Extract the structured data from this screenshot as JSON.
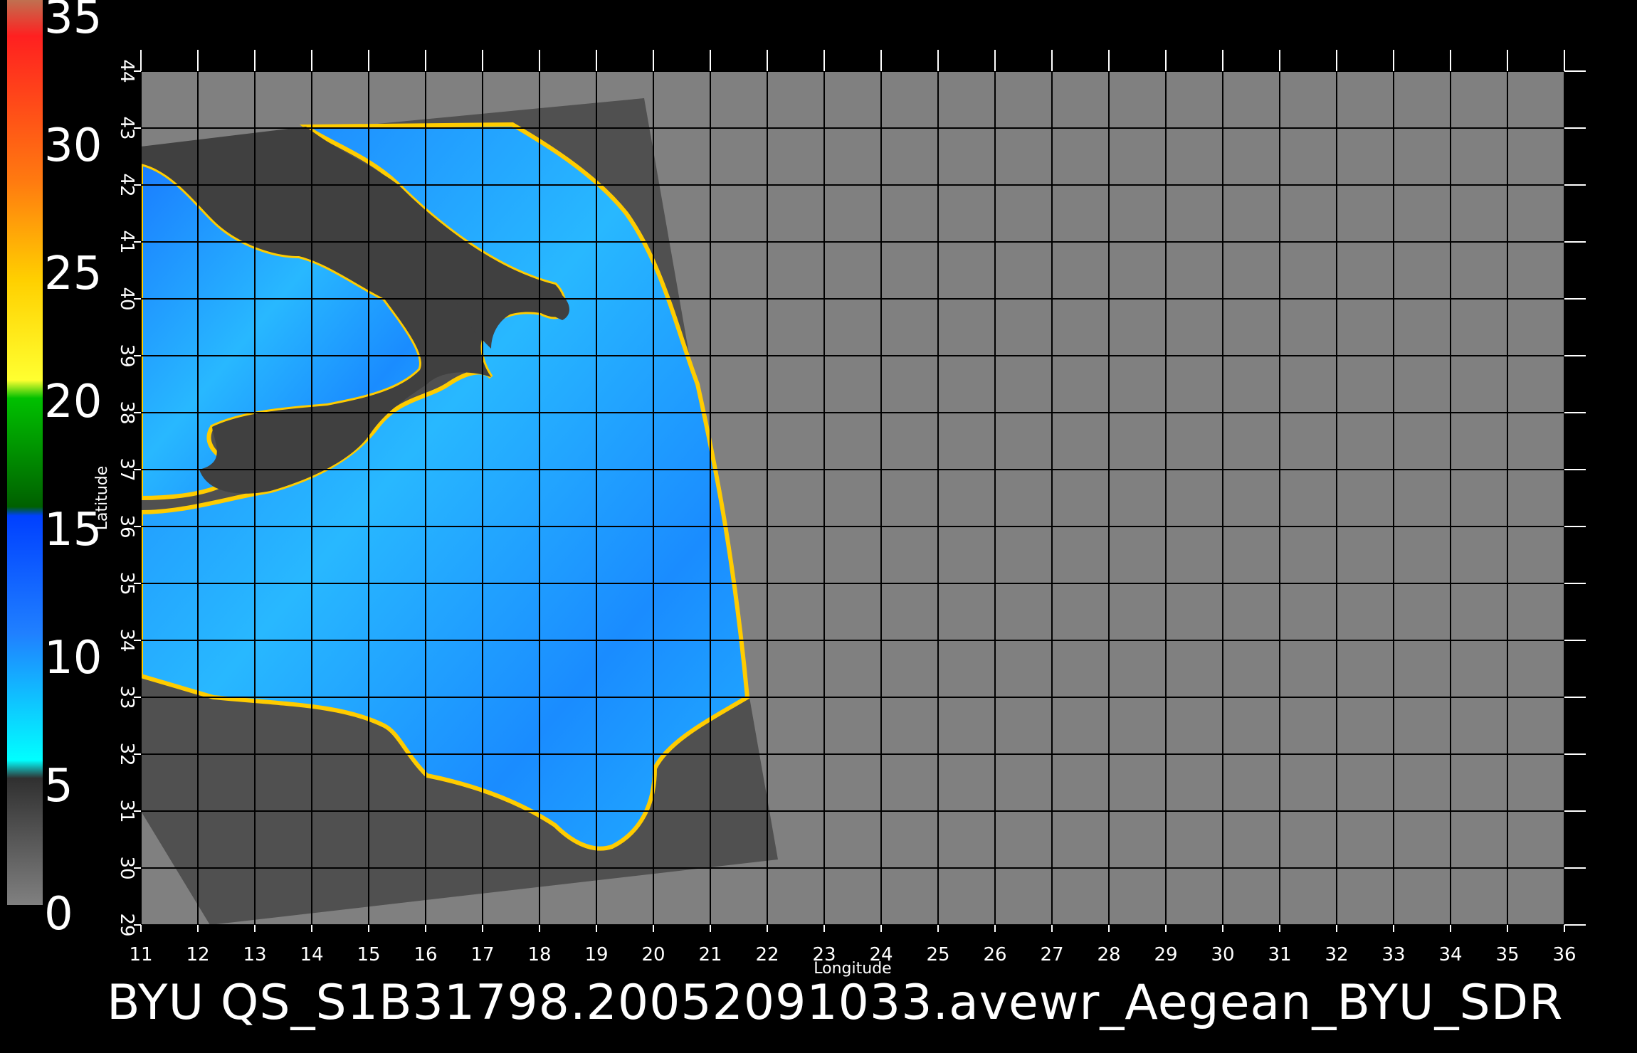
{
  "colorbar": {
    "labels": [
      "35",
      "30",
      "25",
      "20",
      "15",
      "10",
      "5",
      "0"
    ],
    "stops": [
      {
        "color": "#c07050"
      },
      {
        "color": "#ff2020"
      },
      {
        "color": "#ff7a10"
      },
      {
        "color": "#ffd000"
      },
      {
        "color": "#ffff30"
      },
      {
        "color": "#00c000"
      },
      {
        "color": "#006000"
      },
      {
        "color": "#0040ff"
      },
      {
        "color": "#2080ff"
      },
      {
        "color": "#00ffff"
      },
      {
        "color": "#303030"
      },
      {
        "color": "#808080"
      }
    ]
  },
  "map": {
    "lon_range": [
      11,
      36
    ],
    "lat_range": [
      29,
      44
    ],
    "x_ticks": [
      "11",
      "12",
      "13",
      "14",
      "15",
      "16",
      "17",
      "18",
      "19",
      "20",
      "21",
      "22",
      "23",
      "24",
      "25",
      "26",
      "27",
      "28",
      "29",
      "30",
      "31",
      "32",
      "33",
      "34",
      "35",
      "36"
    ],
    "y_ticks": [
      "29",
      "30",
      "31",
      "32",
      "33",
      "34",
      "35",
      "36",
      "37",
      "38",
      "39",
      "40",
      "41",
      "42",
      "43",
      "44"
    ],
    "xlabel": "Longitude",
    "ylabel": "Latitude",
    "background_color": "#808080",
    "swath_color": "#505050",
    "land_color": "#404040",
    "sea_color": "#1e90ff"
  },
  "caption": "BYU QS_S1B31798.20052091033.avewr_Aegean_BYU_SDR"
}
